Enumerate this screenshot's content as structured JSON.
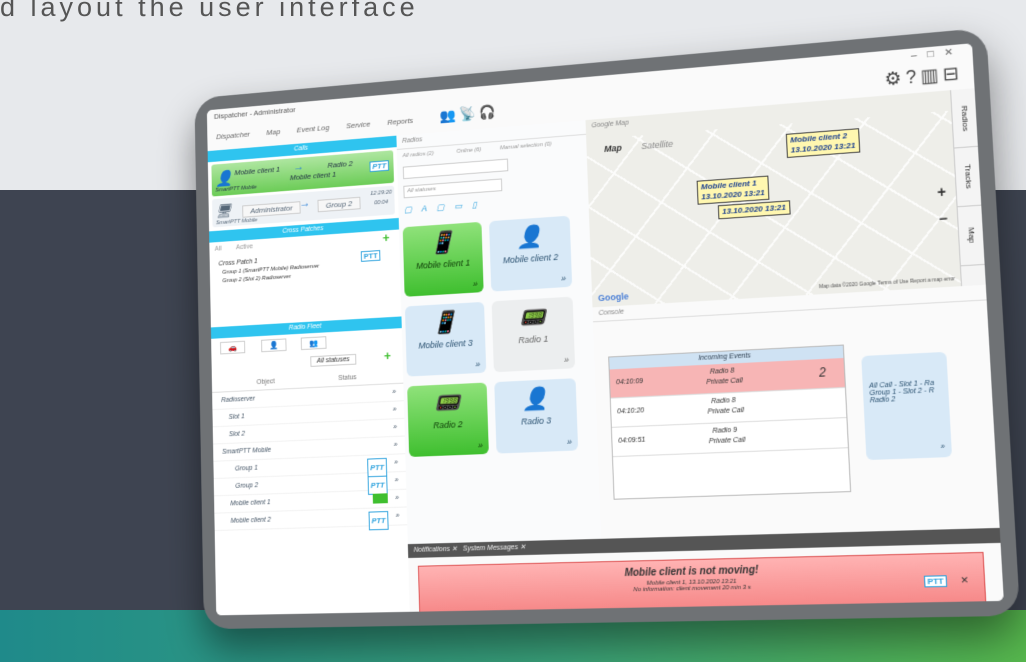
{
  "heading": "d    layout the user interface",
  "window": {
    "title": "Dispatcher - Administrator",
    "controls": [
      "–",
      "□",
      "✕"
    ]
  },
  "menu": [
    "Dispatcher",
    "Map",
    "Event Log",
    "Service",
    "Reports"
  ],
  "topright_icons": [
    "gear-icon",
    "help-icon",
    "panel-icon",
    "layout-icon"
  ],
  "calls": {
    "header": "Calls",
    "card1": {
      "from": "Mobile client 1",
      "arrow": "→",
      "to": "Radio 2",
      "sub": "Mobile client 1",
      "ptt": "PTT",
      "footer": "SmartPTT Mobile"
    },
    "card2": {
      "from": "Administrator",
      "to": "Group 2",
      "time1": "12:29:20",
      "time2": "00:04",
      "footer": "SmartPTT Mobile"
    }
  },
  "cross_patches": {
    "header": "Cross Patches",
    "filters": [
      "All",
      "Active"
    ],
    "add": "+",
    "item_title": "Cross Patch 1",
    "item_line1": "Group 1 (SmartPTT Mobile) Radioserver",
    "item_line2": "Group 2 (Slot 2) Radioserver",
    "ptt": "PTT"
  },
  "radio_fleet": {
    "header": "Radio Fleet",
    "statuses": "All statuses",
    "columns": [
      "Object",
      "Status"
    ],
    "tree": [
      {
        "label": "Radioserver",
        "ptt": ""
      },
      {
        "label": "Slot 1",
        "ptt": ""
      },
      {
        "label": "Slot 2",
        "ptt": ""
      },
      {
        "label": "SmartPTT Mobile",
        "ptt": ""
      },
      {
        "label": "Group 1",
        "ptt": "PTT"
      },
      {
        "label": "Group 2",
        "ptt": "PTT"
      },
      {
        "label": "Mobile client 1",
        "ptt": ""
      },
      {
        "label": "Mobile client 2",
        "ptt": "PTT"
      }
    ]
  },
  "radios": {
    "header": "Radios",
    "options": [
      "All radios (2)",
      "Online (6)",
      "Manual selection (0)"
    ],
    "statuses": "All statuses",
    "tiles": [
      {
        "label": "Mobile client 1",
        "style": "green",
        "icon": "📱"
      },
      {
        "label": "Mobile client 2",
        "style": "blue",
        "icon": "👤"
      },
      {
        "label": "Mobile client 3",
        "style": "blue",
        "icon": "📱"
      },
      {
        "label": "Radio 1",
        "style": "grey",
        "icon": "📟"
      },
      {
        "label": "Radio 2",
        "style": "green",
        "icon": "📟"
      },
      {
        "label": "Radio 3",
        "style": "blue",
        "icon": "👤"
      }
    ],
    "chevron": "»"
  },
  "map": {
    "title": "Google Map",
    "tabs": [
      "Map",
      "Satellite"
    ],
    "labels": [
      {
        "name": "Mobile client 2",
        "time": "13.10.2020 13:21"
      },
      {
        "name": "Mobile client 1",
        "time": "13.10.2020 13:21"
      },
      {
        "name": "",
        "time": "13.10.2020 13:21"
      }
    ],
    "zoom_in": "+",
    "zoom_out": "−",
    "google": "Google",
    "attribution": "Map data ©2020 Google   Terms of Use   Report a map error",
    "side_tabs": [
      "Radios",
      "Tracks",
      "Objects on Map"
    ]
  },
  "console": {
    "title": "Console",
    "incoming_header": "Incoming Events",
    "events": [
      {
        "time": "04:10:09",
        "name": "Radio 8",
        "type": "Private Call",
        "count": "2"
      },
      {
        "time": "04:10:20",
        "name": "Radio 8",
        "type": "Private Call",
        "count": ""
      },
      {
        "time": "04:09:51",
        "name": "Radio 9",
        "type": "Private Call",
        "count": ""
      }
    ],
    "allcall": "All Call - Slot 1 - Ra Group 1 - Slot 2 - R Radio 2",
    "chevron": "»"
  },
  "notifications": {
    "tabs": [
      "Notifications",
      "System Messages"
    ],
    "alert_title": "Mobile client is not moving!",
    "alert_line1": "Mobile client 1, 13.10.2020 13:21",
    "alert_line2": "No information: client movement 20 min 3 s",
    "ptt": "PTT",
    "close": "✕"
  },
  "colors": {
    "accent": "#2fc4ef",
    "green": "#3fbf2f",
    "alert": "#f47f7f"
  }
}
